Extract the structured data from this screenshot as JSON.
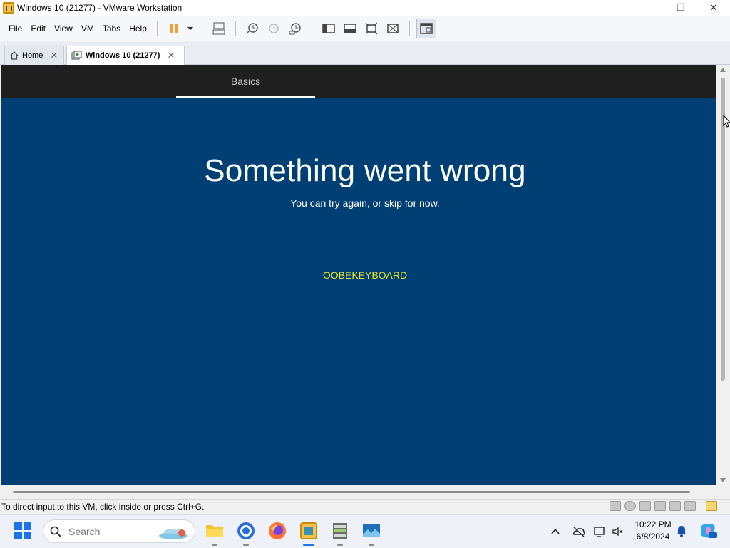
{
  "window": {
    "title": "Windows 10 (21277) - VMware Workstation",
    "minimize": "—",
    "maximize": "❐",
    "close": "✕"
  },
  "menu": {
    "items": [
      "File",
      "Edit",
      "View",
      "VM",
      "Tabs",
      "Help"
    ]
  },
  "tabs": [
    {
      "label": "Home",
      "close": "✕"
    },
    {
      "label": "Windows 10 (21277)",
      "close": "✕"
    }
  ],
  "oobe": {
    "section_tab": "Basics",
    "heading": "Something went wrong",
    "subtitle": "You can try again, or skip for now.",
    "error_code": "OOBEKEYBOARD",
    "colors": {
      "background": "#003f74",
      "header": "#1f1f1f",
      "error": "#e8e82a"
    }
  },
  "status": {
    "message": "To direct input to this VM, click inside or press Ctrl+G."
  },
  "taskbar": {
    "search_placeholder": "Search",
    "clock_time": "10:22 PM",
    "clock_date": "6/8/2024",
    "apps": [
      "start-icon",
      "file-explorer-icon",
      "chrome-icon",
      "firefox-icon",
      "vmware-icon",
      "terminal-icon",
      "photos-icon"
    ]
  }
}
